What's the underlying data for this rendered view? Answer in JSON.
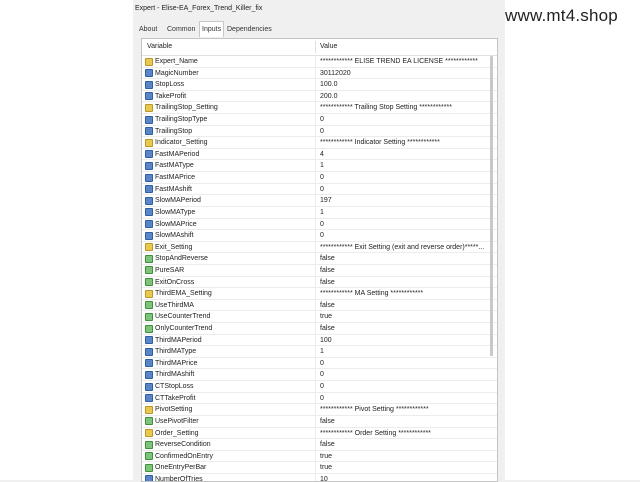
{
  "window": {
    "title": "Expert - Elise-EA_Forex_Trend_Killer_fix",
    "watermark": "www.mt4.shop"
  },
  "tabs": [
    {
      "label": "About",
      "active": false
    },
    {
      "label": "Common",
      "active": false
    },
    {
      "label": "Inputs",
      "active": true
    },
    {
      "label": "Dependencies",
      "active": false
    }
  ],
  "table": {
    "columns": [
      "Variable",
      "Value"
    ],
    "rows": [
      {
        "icon": "ab-icon",
        "name": "Expert_Name",
        "value": "************ ELISE TREND EA LICENSE ************"
      },
      {
        "icon": "num-icon",
        "name": "MagicNumber",
        "value": "30112020"
      },
      {
        "icon": "num-icon",
        "name": "StopLoss",
        "value": "100.0"
      },
      {
        "icon": "num-icon",
        "name": "TakeProfit",
        "value": "200.0"
      },
      {
        "icon": "ab-icon",
        "name": "TrailingStop_Setting",
        "value": "************ Trailing Stop Setting ************"
      },
      {
        "icon": "num-icon",
        "name": "TrailingStopType",
        "value": "0"
      },
      {
        "icon": "num-icon",
        "name": "TrailingStop",
        "value": "0"
      },
      {
        "icon": "ab-icon",
        "name": "Indicator_Setting",
        "value": "************ Indicator Setting ************"
      },
      {
        "icon": "num-icon",
        "name": "FastMAPeriod",
        "value": "4"
      },
      {
        "icon": "num-icon",
        "name": "FastMAType",
        "value": "1"
      },
      {
        "icon": "num-icon",
        "name": "FastMAPrice",
        "value": "0"
      },
      {
        "icon": "num-icon",
        "name": "FastMAshift",
        "value": "0"
      },
      {
        "icon": "num-icon",
        "name": "SlowMAPeriod",
        "value": "197"
      },
      {
        "icon": "num-icon",
        "name": "SlowMAType",
        "value": "1"
      },
      {
        "icon": "num-icon",
        "name": "SlowMAPrice",
        "value": "0"
      },
      {
        "icon": "num-icon",
        "name": "SlowMAshift",
        "value": "0"
      },
      {
        "icon": "ab-icon",
        "name": "Exit_Setting",
        "value": "************ Exit Setting (exit and reverse order)*****..."
      },
      {
        "icon": "bool-icon",
        "name": "StopAndReverse",
        "value": "false"
      },
      {
        "icon": "bool-icon",
        "name": "PureSAR",
        "value": "false"
      },
      {
        "icon": "bool-icon",
        "name": "ExitOnCross",
        "value": "false"
      },
      {
        "icon": "ab-icon",
        "name": "ThirdEMA_Setting",
        "value": "************ MA Setting ************"
      },
      {
        "icon": "bool-icon",
        "name": "UseThirdMA",
        "value": "false"
      },
      {
        "icon": "bool-icon",
        "name": "UseCounterTrend",
        "value": "true"
      },
      {
        "icon": "bool-icon",
        "name": "OnlyCounterTrend",
        "value": "false"
      },
      {
        "icon": "num-icon",
        "name": "ThirdMAPeriod",
        "value": "100"
      },
      {
        "icon": "num-icon",
        "name": "ThirdMAType",
        "value": "1"
      },
      {
        "icon": "num-icon",
        "name": "ThirdMAPrice",
        "value": "0"
      },
      {
        "icon": "num-icon",
        "name": "ThirdMAshift",
        "value": "0"
      },
      {
        "icon": "num-icon",
        "name": "CTStopLoss",
        "value": "0"
      },
      {
        "icon": "num-icon",
        "name": "CTTakeProfit",
        "value": "0"
      },
      {
        "icon": "ab-icon",
        "name": "PivotSetting",
        "value": "************ Pivot Setting ************"
      },
      {
        "icon": "bool-icon",
        "name": "UsePivotFilter",
        "value": "false"
      },
      {
        "icon": "ab-icon",
        "name": "Order_Setting",
        "value": "************ Order Setting ************"
      },
      {
        "icon": "bool-icon",
        "name": "ReverseCondition",
        "value": "false"
      },
      {
        "icon": "bool-icon",
        "name": "ConfirmedOnEntry",
        "value": "true"
      },
      {
        "icon": "bool-icon",
        "name": "OneEntryPerBar",
        "value": "true"
      },
      {
        "icon": "num-icon",
        "name": "NumberOfTries",
        "value": "10"
      }
    ]
  }
}
